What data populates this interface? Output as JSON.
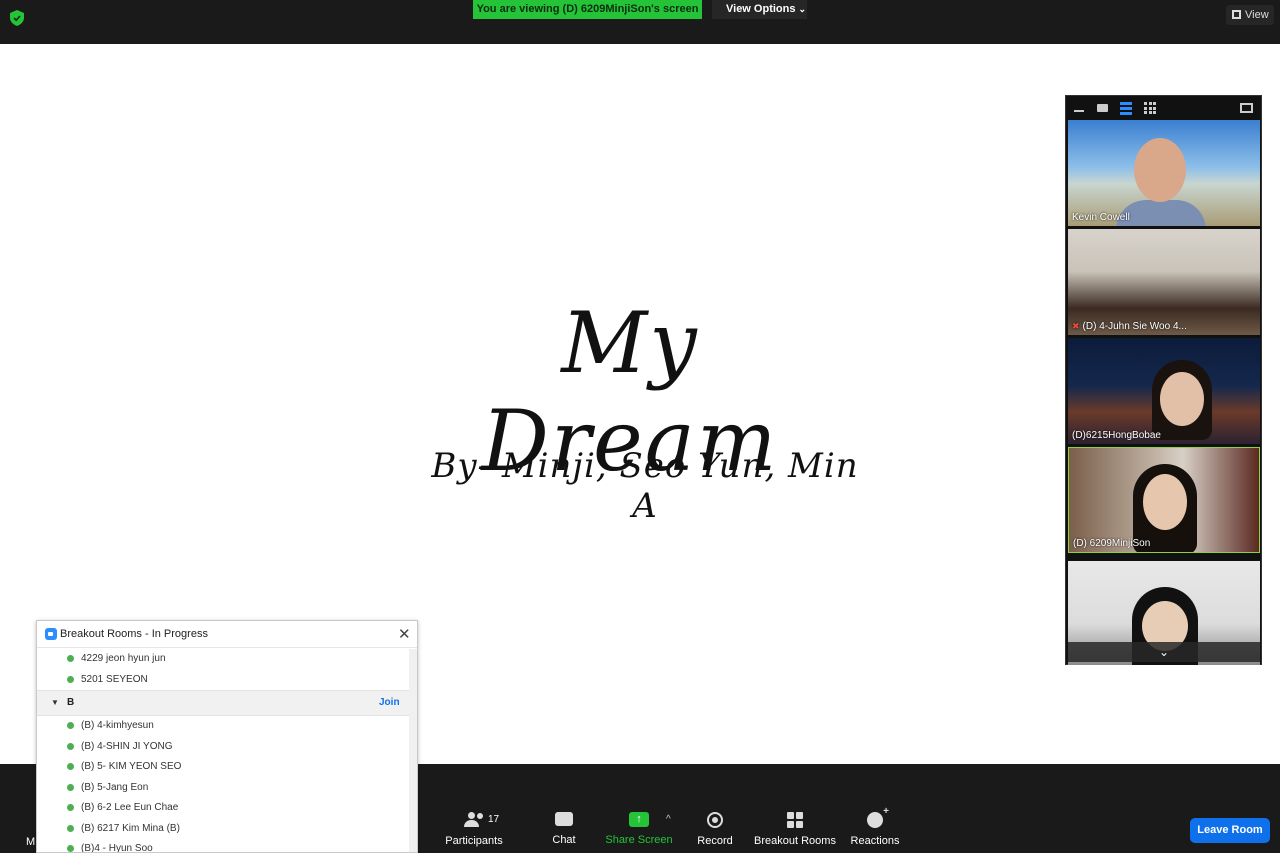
{
  "topbar": {
    "viewing_banner": "You are viewing (D) 6209MinjiSon's screen",
    "view_options_label": "View Options",
    "view_label": "View"
  },
  "slide": {
    "title": "My Dream",
    "subtitle": "By- Minji, Seo Yun, Min  A"
  },
  "video_panel": {
    "tiles": [
      {
        "name": "Kevin Cowell",
        "muted": false
      },
      {
        "name": "(D) 4-Juhn Sie Woo 4...",
        "muted": true
      },
      {
        "name": "(D)6215HongBobae",
        "muted": false
      },
      {
        "name": "(D) 6209MinjiSon",
        "muted": false,
        "active": true
      },
      {
        "name": "",
        "muted": false
      }
    ]
  },
  "toolbar": {
    "mute_label": "M",
    "participants_label": "Participants",
    "participants_count": "17",
    "chat_label": "Chat",
    "share_label": "Share Screen",
    "record_label": "Record",
    "breakout_label": "Breakout Rooms",
    "reactions_label": "Reactions",
    "leave_label": "Leave Room",
    "share_color": "#25c438",
    "leave_color": "#0e71eb"
  },
  "breakout": {
    "title": "Breakout Rooms - In Progress",
    "rows_before": [
      "4229 jeon hyun jun",
      "5201 SEYEON"
    ],
    "room_name": "B",
    "join_label": "Join",
    "rows_after": [
      "(B) 4-kimhyesun",
      "(B) 4-SHIN JI YONG",
      "(B) 5- KIM YEON SEO",
      "(B) 5-Jang Eon",
      "(B) 6-2 Lee Eun Chae",
      "(B) 6217 Kim Mina (B)",
      "(B)4 - Hyun Soo"
    ]
  }
}
